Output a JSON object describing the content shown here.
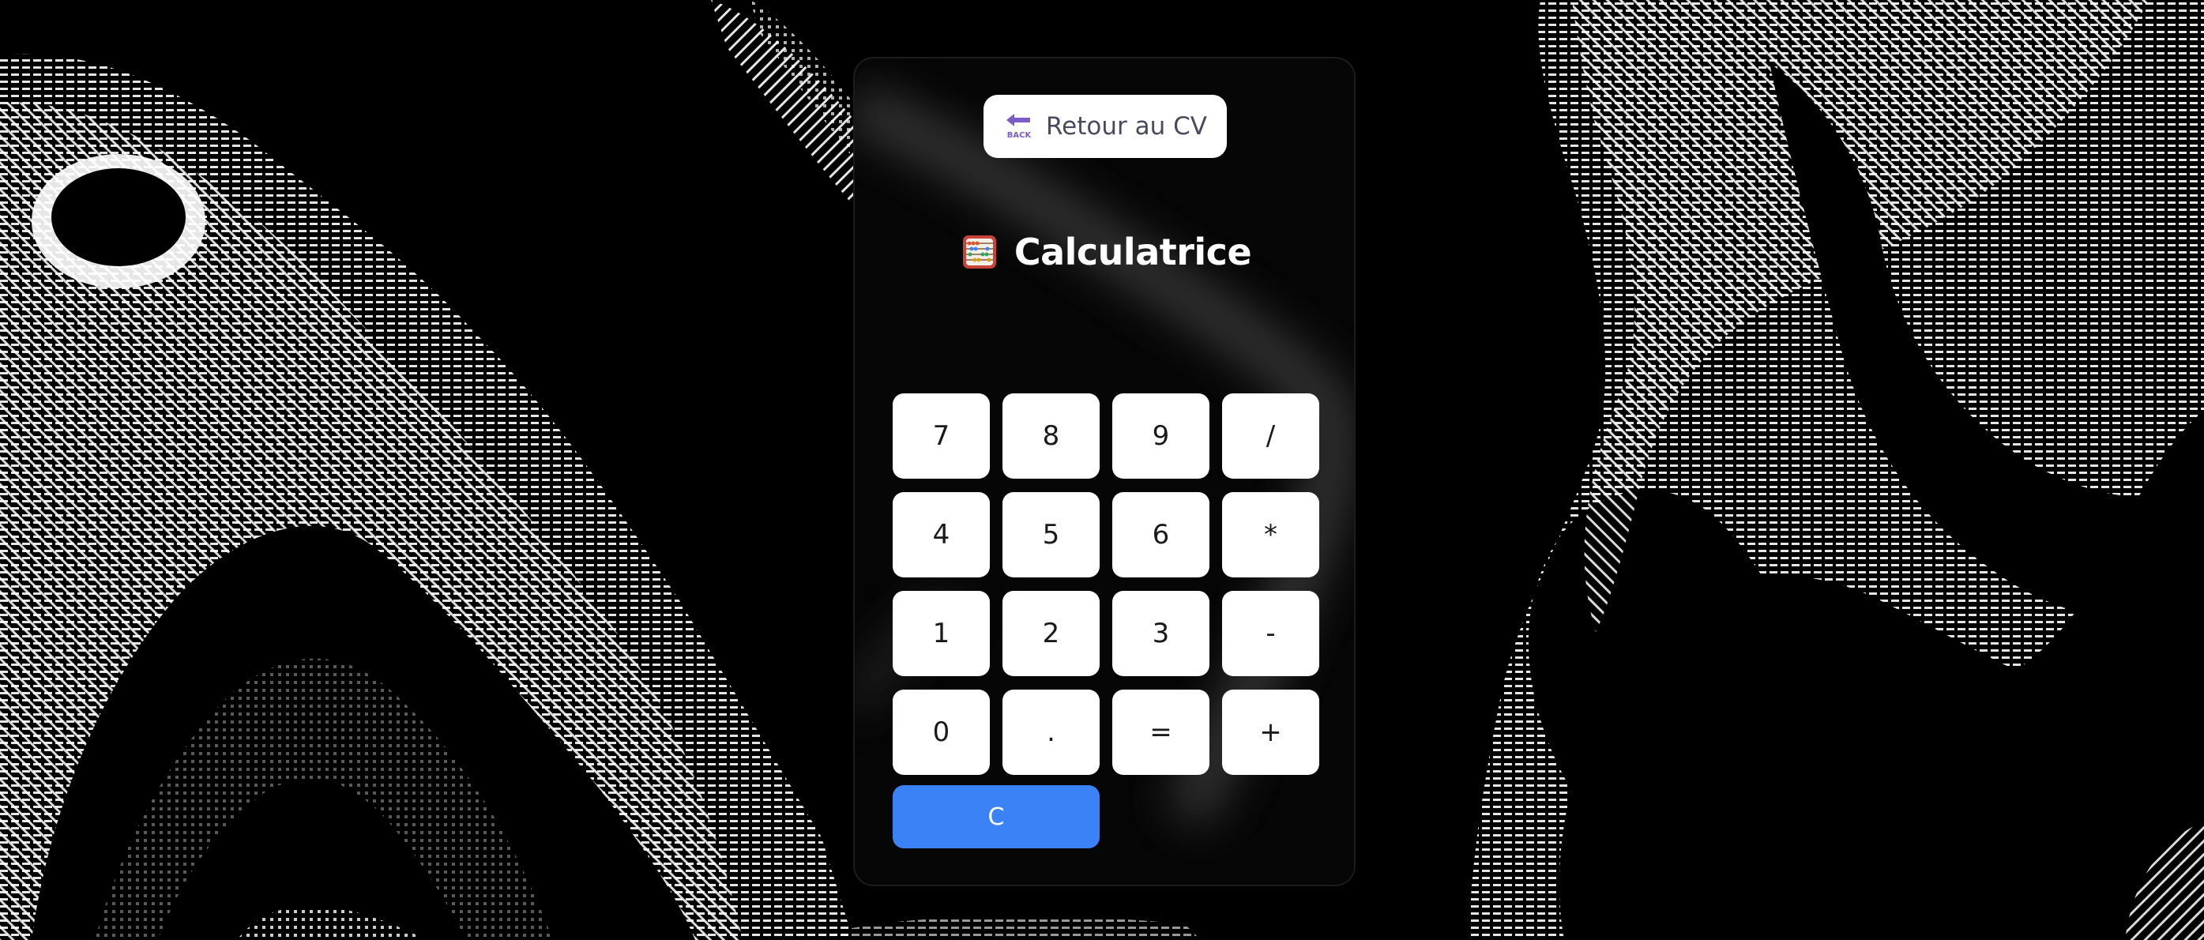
{
  "header": {
    "back_label": "Retour au CV",
    "back_icon": "back-arrow-icon",
    "back_icon_text": "BACK",
    "title": "Calculatrice",
    "title_icon": "abacus-icon"
  },
  "display": {
    "value": ""
  },
  "keypad": {
    "keys": [
      {
        "label": "7",
        "name": "key-7"
      },
      {
        "label": "8",
        "name": "key-8"
      },
      {
        "label": "9",
        "name": "key-9"
      },
      {
        "label": "/",
        "name": "key-divide"
      },
      {
        "label": "4",
        "name": "key-4"
      },
      {
        "label": "5",
        "name": "key-5"
      },
      {
        "label": "6",
        "name": "key-6"
      },
      {
        "label": "*",
        "name": "key-multiply"
      },
      {
        "label": "1",
        "name": "key-1"
      },
      {
        "label": "2",
        "name": "key-2"
      },
      {
        "label": "3",
        "name": "key-3"
      },
      {
        "label": "-",
        "name": "key-subtract"
      },
      {
        "label": "0",
        "name": "key-0"
      },
      {
        "label": ".",
        "name": "key-decimal"
      },
      {
        "label": "=",
        "name": "key-equals"
      },
      {
        "label": "+",
        "name": "key-add"
      }
    ],
    "clear_label": "C"
  },
  "colors": {
    "background": "#000000",
    "card": "#060606",
    "key": "#ffffff",
    "key_text": "#1a1a1a",
    "clear": "#3b82f6",
    "back_icon": "#7c5cc9",
    "pattern": "#ffffff"
  }
}
